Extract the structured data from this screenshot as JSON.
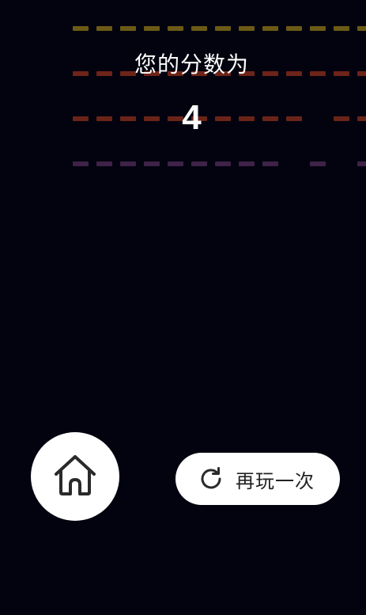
{
  "game_over": {
    "score_label": "您的分数为",
    "score_value": "4"
  },
  "bricks": {
    "rows": [
      {
        "color": "#6b5a16",
        "pattern": [
          1,
          1,
          1,
          1,
          1,
          1,
          1,
          1,
          1,
          1,
          1,
          1,
          1
        ]
      },
      {
        "color": "#6e2418",
        "pattern": [
          1,
          1,
          1,
          1,
          1,
          1,
          1,
          1,
          1,
          1,
          1,
          1,
          1
        ]
      },
      {
        "color": "#6a2418",
        "pattern": [
          1,
          1,
          1,
          1,
          1,
          1,
          1,
          1,
          1,
          1,
          0,
          1,
          1
        ]
      },
      {
        "color": "#3e2248",
        "pattern": [
          1,
          1,
          1,
          1,
          1,
          1,
          1,
          1,
          1,
          0,
          1,
          0,
          1
        ]
      }
    ]
  },
  "actions": {
    "home_icon": "home-icon",
    "replay_icon": "refresh-icon",
    "replay_label": "再玩一次"
  },
  "colors": {
    "background": "#03030f",
    "text": "#ffffff",
    "button_bg": "#ffffff",
    "button_text": "#222222"
  }
}
